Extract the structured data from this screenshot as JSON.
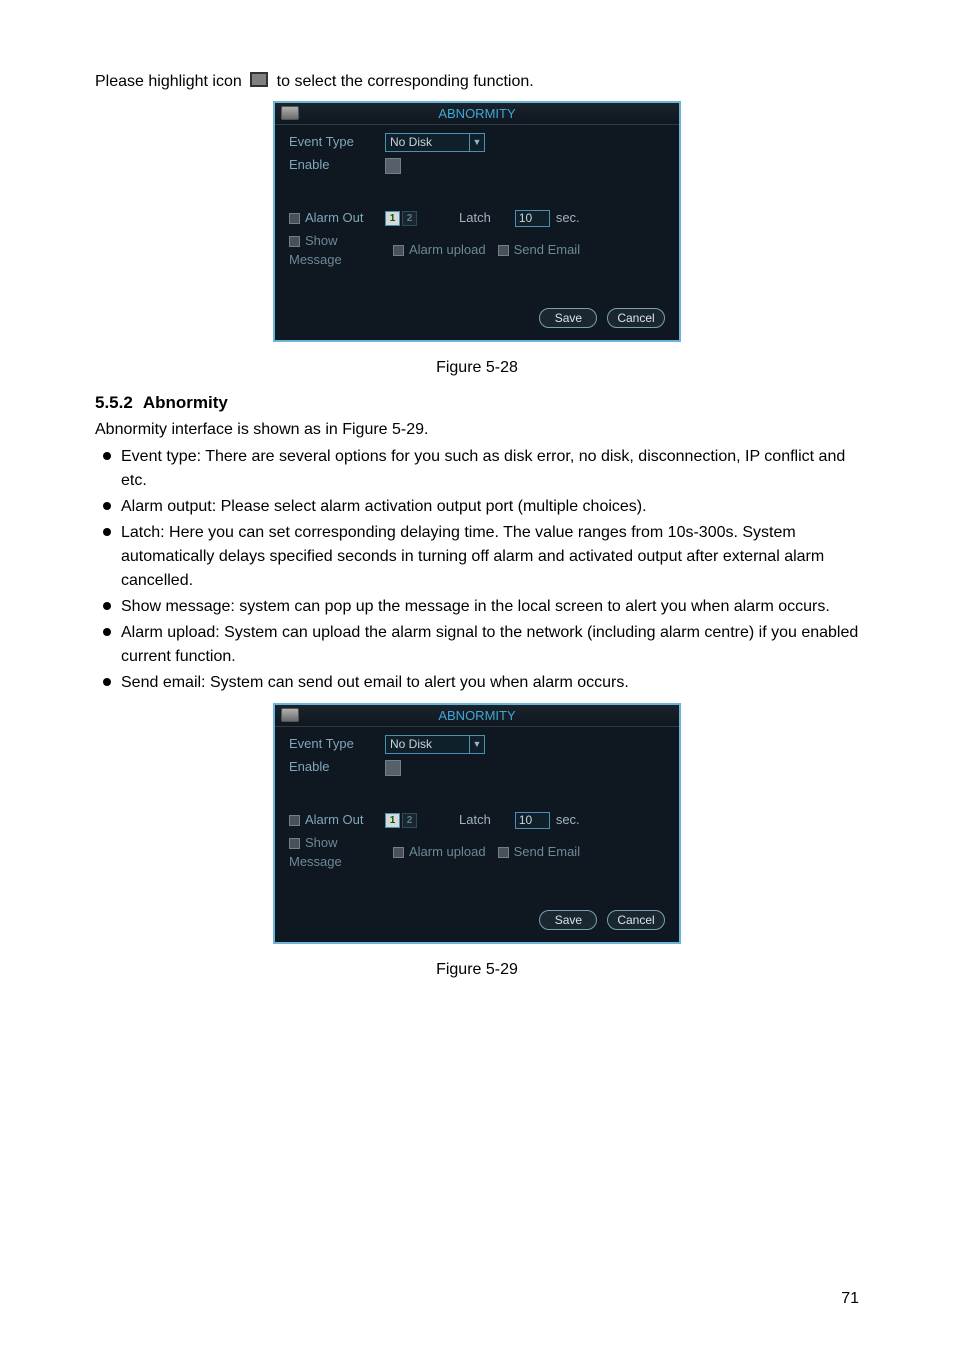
{
  "intro_before": "Please highlight icon",
  "intro_after": "to select the corresponding function.",
  "fig28": {
    "title": "ABNORMITY",
    "event_type_label": "Event Type",
    "event_type_value": "No Disk",
    "enable_label": "Enable",
    "alarm_out_label": "Alarm Out",
    "num1": "1",
    "num2": "2",
    "latch_label": "Latch",
    "latch_value": "10",
    "sec_label": "sec.",
    "show_message_label": "Show Message",
    "alarm_upload_label": "Alarm upload",
    "send_email_label": "Send Email",
    "save_btn": "Save",
    "cancel_btn": "Cancel",
    "caption": "Figure 5-28"
  },
  "section": {
    "num": "5.5.2",
    "title": "Abnormity"
  },
  "para_after_heading": "Abnormity interface is shown as in Figure 5-29.",
  "bullets": [
    "Event type: There are several options for you such as disk error, no disk, disconnection, IP conflict and etc.",
    "Alarm output: Please select alarm activation output port (multiple choices).",
    "Latch: Here you can set corresponding delaying time. The value ranges from 10s-300s. System automatically delays specified seconds in turning off alarm and activated output after external alarm cancelled.",
    "Show message: system can pop up the message in the local screen to alert you when alarm occurs.",
    "Alarm upload: System can upload the alarm signal to the network (including alarm centre) if you enabled current function.",
    "Send email: System can send out email to alert you when alarm occurs."
  ],
  "fig29": {
    "title": "ABNORMITY",
    "event_type_label": "Event Type",
    "event_type_value": "No Disk",
    "enable_label": "Enable",
    "alarm_out_label": "Alarm Out",
    "num1": "1",
    "num2": "2",
    "latch_label": "Latch",
    "latch_value": "10",
    "sec_label": "sec.",
    "show_message_label": "Show Message",
    "alarm_upload_label": "Alarm upload",
    "send_email_label": "Send Email",
    "save_btn": "Save",
    "cancel_btn": "Cancel",
    "caption": "Figure 5-29"
  },
  "page_number": "71"
}
